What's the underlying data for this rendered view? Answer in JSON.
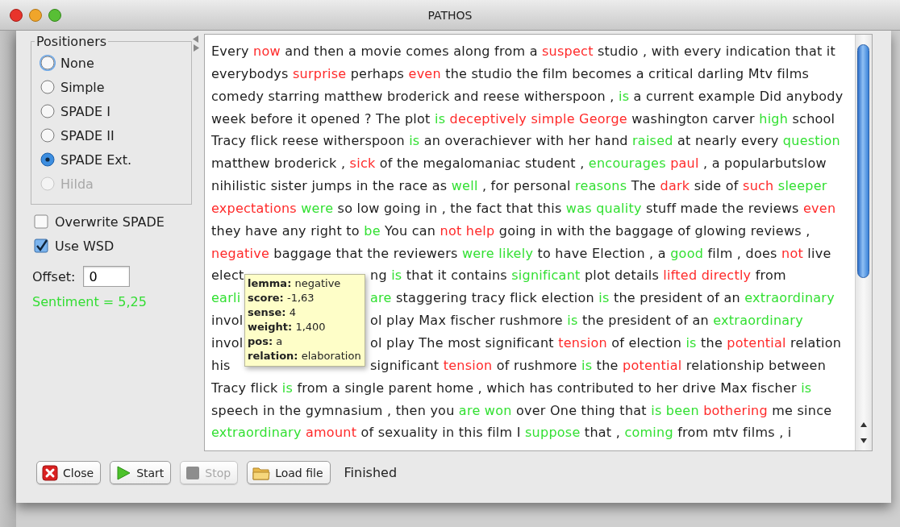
{
  "window": {
    "title": "PATHOS"
  },
  "positioners": {
    "title": "Positioners",
    "options": [
      {
        "label": "None",
        "selected": false,
        "focused": true,
        "disabled": false
      },
      {
        "label": "Simple",
        "selected": false,
        "focused": false,
        "disabled": false
      },
      {
        "label": "SPADE I",
        "selected": false,
        "focused": false,
        "disabled": false
      },
      {
        "label": "SPADE II",
        "selected": false,
        "focused": false,
        "disabled": false
      },
      {
        "label": "SPADE Ext.",
        "selected": true,
        "focused": false,
        "disabled": false
      },
      {
        "label": "Hilda",
        "selected": false,
        "focused": false,
        "disabled": true
      }
    ]
  },
  "checkboxes": [
    {
      "label": "Overwrite SPADE",
      "checked": false
    },
    {
      "label": "Use WSD",
      "checked": true
    }
  ],
  "offset": {
    "label": "Offset:",
    "value": "0"
  },
  "sentiment": "Sentiment = 5,25",
  "text_lines": [
    {
      "segments": [
        {
          "text": "Every ",
          "color": "#1e1e1e"
        },
        {
          "text": "now",
          "color": "#ff2a2a"
        },
        {
          "text": " and then a movie comes along from a ",
          "color": "#1e1e1e"
        },
        {
          "text": "suspect",
          "color": "#ff2a2a"
        },
        {
          "text": " studio , with every indication that it",
          "color": "#1e1e1e"
        }
      ]
    },
    {
      "segments": [
        {
          "text": "everybodys ",
          "color": "#1e1e1e"
        },
        {
          "text": "surprise",
          "color": "#ff2a2a"
        },
        {
          "text": " perhaps ",
          "color": "#1e1e1e"
        },
        {
          "text": "even",
          "color": "#ff2a2a"
        },
        {
          "text": " the studio the film becomes a critical darling Mtv films",
          "color": "#1e1e1e"
        }
      ]
    },
    {
      "segments": [
        {
          "text": "comedy starring matthew broderick and reese witherspoon , ",
          "color": "#1e1e1e"
        },
        {
          "text": "is",
          "color": "#33e033"
        },
        {
          "text": " a current example Did anybody",
          "color": "#1e1e1e"
        }
      ]
    },
    {
      "segments": [
        {
          "text": "week before it opened ? The plot ",
          "color": "#1e1e1e"
        },
        {
          "text": "is ",
          "color": "#33e033"
        },
        {
          "text": "deceptively simple George",
          "color": "#ff2a2a"
        },
        {
          "text": " washington carver ",
          "color": "#1e1e1e"
        },
        {
          "text": "high",
          "color": "#33e033"
        },
        {
          "text": " school",
          "color": "#1e1e1e"
        }
      ]
    },
    {
      "segments": [
        {
          "text": "Tracy flick reese witherspoon ",
          "color": "#1e1e1e"
        },
        {
          "text": "is",
          "color": "#33e033"
        },
        {
          "text": " an overachiever with her hand ",
          "color": "#1e1e1e"
        },
        {
          "text": "raised",
          "color": "#33e033"
        },
        {
          "text": " at nearly every ",
          "color": "#1e1e1e"
        },
        {
          "text": "question",
          "color": "#33e033"
        }
      ]
    },
    {
      "segments": [
        {
          "text": "matthew broderick , ",
          "color": "#1e1e1e"
        },
        {
          "text": "sick",
          "color": "#ff2a2a"
        },
        {
          "text": " of the megalomaniac student , ",
          "color": "#1e1e1e"
        },
        {
          "text": "encourages ",
          "color": "#33e033"
        },
        {
          "text": "paul",
          "color": "#ff2a2a"
        },
        {
          "text": " , a popularbutslow",
          "color": "#1e1e1e"
        }
      ]
    },
    {
      "segments": [
        {
          "text": "nihilistic sister jumps in the race as ",
          "color": "#1e1e1e"
        },
        {
          "text": "well",
          "color": "#33e033"
        },
        {
          "text": " , for personal ",
          "color": "#1e1e1e"
        },
        {
          "text": "reasons",
          "color": "#33e033"
        },
        {
          "text": " The ",
          "color": "#1e1e1e"
        },
        {
          "text": "dark",
          "color": "#ff2a2a"
        },
        {
          "text": " side of ",
          "color": "#1e1e1e"
        },
        {
          "text": "such ",
          "color": "#ff2a2a"
        },
        {
          "text": "sleeper",
          "color": "#33e033"
        }
      ]
    },
    {
      "segments": [
        {
          "text": "expectations ",
          "color": "#ff2a2a"
        },
        {
          "text": "were",
          "color": "#33e033"
        },
        {
          "text": " so low going in , the fact that this ",
          "color": "#1e1e1e"
        },
        {
          "text": "was quality",
          "color": "#33e033"
        },
        {
          "text": " stuff made the reviews ",
          "color": "#1e1e1e"
        },
        {
          "text": "even",
          "color": "#ff2a2a"
        }
      ]
    },
    {
      "segments": [
        {
          "text": "they have any right to ",
          "color": "#1e1e1e"
        },
        {
          "text": "be",
          "color": "#33e033"
        },
        {
          "text": " You can ",
          "color": "#1e1e1e"
        },
        {
          "text": "not help",
          "color": "#ff2a2a"
        },
        {
          "text": " going in with the baggage of glowing reviews ,",
          "color": "#1e1e1e"
        }
      ]
    },
    {
      "segments": [
        {
          "text": "negative",
          "color": "#ff2a2a"
        },
        {
          "text": " baggage that the reviewers ",
          "color": "#1e1e1e"
        },
        {
          "text": "were likely",
          "color": "#33e033"
        },
        {
          "text": " to have Election , a ",
          "color": "#1e1e1e"
        },
        {
          "text": "good",
          "color": "#33e033"
        },
        {
          "text": " film , does ",
          "color": "#1e1e1e"
        },
        {
          "text": "not",
          "color": "#ff2a2a"
        },
        {
          "text": " live",
          "color": "#1e1e1e"
        }
      ]
    },
    {
      "segments": [
        {
          "text": "elect",
          "color": "#1e1e1e"
        },
        {
          "kind": "covered"
        },
        {
          "text": "ng ",
          "color": "#1e1e1e"
        },
        {
          "text": "is",
          "color": "#33e033"
        },
        {
          "text": " that it contains ",
          "color": "#1e1e1e"
        },
        {
          "text": "significant",
          "color": "#33e033"
        },
        {
          "text": " plot details ",
          "color": "#1e1e1e"
        },
        {
          "text": "lifted directly",
          "color": "#ff2a2a"
        },
        {
          "text": " from",
          "color": "#1e1e1e"
        }
      ]
    },
    {
      "segments": [
        {
          "text": "earli",
          "color": "#33e033"
        },
        {
          "kind": "covered"
        },
        {
          "text": "are",
          "color": "#33e033"
        },
        {
          "text": " staggering tracy flick election ",
          "color": "#1e1e1e"
        },
        {
          "text": "is",
          "color": "#33e033"
        },
        {
          "text": " the president of an ",
          "color": "#1e1e1e"
        },
        {
          "text": "extraordinary",
          "color": "#33e033"
        }
      ]
    },
    {
      "segments": [
        {
          "text": "invol",
          "color": "#1e1e1e"
        },
        {
          "kind": "covered"
        },
        {
          "text": "ol play Max fischer rushmore ",
          "color": "#1e1e1e"
        },
        {
          "text": "is",
          "color": "#33e033"
        },
        {
          "text": " the president of an ",
          "color": "#1e1e1e"
        },
        {
          "text": "extraordinary",
          "color": "#33e033"
        }
      ]
    },
    {
      "segments": [
        {
          "text": "invol",
          "color": "#1e1e1e"
        },
        {
          "kind": "covered"
        },
        {
          "text": "ol play The most significant ",
          "color": "#1e1e1e"
        },
        {
          "text": "tension",
          "color": "#ff2a2a"
        },
        {
          "text": " of election ",
          "color": "#1e1e1e"
        },
        {
          "text": "is",
          "color": "#33e033"
        },
        {
          "text": " the ",
          "color": "#1e1e1e"
        },
        {
          "text": "potential",
          "color": "#ff2a2a"
        },
        {
          "text": " relation",
          "color": "#1e1e1e"
        }
      ]
    },
    {
      "segments": [
        {
          "text": "his",
          "color": "#1e1e1e"
        },
        {
          "kind": "covered"
        },
        {
          "text": "significant ",
          "color": "#1e1e1e"
        },
        {
          "text": "tension",
          "color": "#ff2a2a"
        },
        {
          "text": " of rushmore ",
          "color": "#1e1e1e"
        },
        {
          "text": "is",
          "color": "#33e033"
        },
        {
          "text": " the ",
          "color": "#1e1e1e"
        },
        {
          "text": "potential",
          "color": "#ff2a2a"
        },
        {
          "text": " relationship between",
          "color": "#1e1e1e"
        }
      ]
    },
    {
      "segments": [
        {
          "text": "Tracy flick ",
          "color": "#1e1e1e"
        },
        {
          "text": "is",
          "color": "#33e033"
        },
        {
          "text": " from a single parent home , which has contributed to her drive Max fischer ",
          "color": "#1e1e1e"
        },
        {
          "text": "is",
          "color": "#33e033"
        }
      ]
    },
    {
      "segments": [
        {
          "text": "speech in the gymnasium , then you ",
          "color": "#1e1e1e"
        },
        {
          "text": "are won",
          "color": "#33e033"
        },
        {
          "text": " over One thing that ",
          "color": "#1e1e1e"
        },
        {
          "text": "is been ",
          "color": "#33e033"
        },
        {
          "text": "bothering",
          "color": "#ff2a2a"
        },
        {
          "text": " me since",
          "color": "#1e1e1e"
        }
      ]
    },
    {
      "segments": [
        {
          "text": "extraordinary ",
          "color": "#33e033"
        },
        {
          "text": "amount",
          "color": "#ff2a2a"
        },
        {
          "text": " of sexuality in this film I ",
          "color": "#1e1e1e"
        },
        {
          "text": "suppose",
          "color": "#33e033"
        },
        {
          "text": " that , ",
          "color": "#1e1e1e"
        },
        {
          "text": "coming",
          "color": "#33e033"
        },
        {
          "text": " from mtv films , i",
          "color": "#1e1e1e"
        }
      ]
    }
  ],
  "tooltip": [
    "**lemma:** negative",
    "**score:** -1,63",
    "**sense:** 4",
    "**weight:** 1,400",
    "**pos:** a",
    "**relation:** elaboration"
  ],
  "buttons": [
    {
      "label": "Close",
      "kind": "close",
      "disabled": false
    },
    {
      "label": "Start",
      "kind": "start",
      "disabled": false
    },
    {
      "label": "Stop",
      "kind": "stop",
      "disabled": true
    },
    {
      "label": "Load file",
      "kind": "load",
      "disabled": false
    }
  ],
  "status": "Finished"
}
